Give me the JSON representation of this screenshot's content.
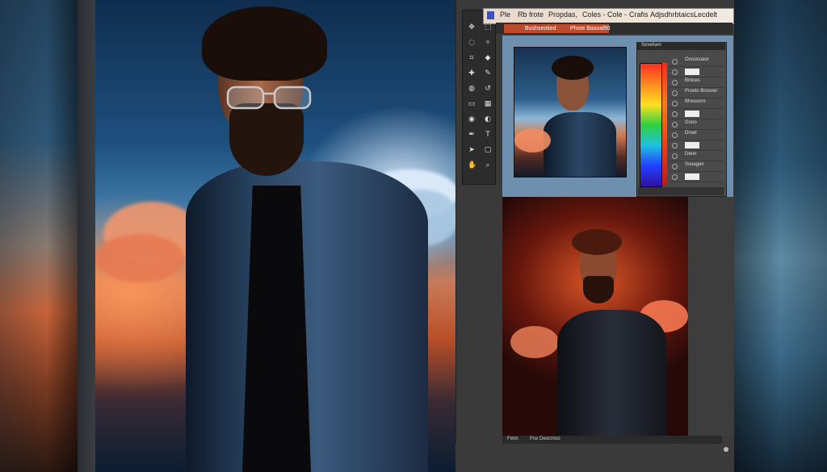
{
  "app": {
    "menu": [
      "Ple",
      "Rb frote",
      "Propdas,",
      "Coles - Cole -",
      "Crafis",
      "Adjsdhrbtaics",
      "Lecdelt"
    ],
    "tab_left": "Bushseotied",
    "tab_right": "Phote Basoal90"
  },
  "panel": {
    "header": "Sovelsen",
    "layers": [
      {
        "label": "Oooocoaor"
      },
      {
        "label": ""
      },
      {
        "label": "Bntoes"
      },
      {
        "label": "Proeto Broover"
      },
      {
        "label": "Bheosoro"
      },
      {
        "label": ""
      },
      {
        "label": "Gooo"
      },
      {
        "label": "Droet"
      },
      {
        "label": ""
      },
      {
        "label": "Dteer"
      },
      {
        "label": "Ssoagen"
      },
      {
        "label": ""
      }
    ]
  },
  "status": {
    "zoom": "Fetm",
    "info": "Pce Deocmoo"
  },
  "colors": {
    "tab_accent": "#bd4a2c",
    "menubar": "#f3eadf"
  },
  "icons": [
    "move-icon",
    "marquee-icon",
    "lasso-icon",
    "magic-wand-icon",
    "crop-icon",
    "eyedropper-icon",
    "healing-icon",
    "brush-icon",
    "stamp-icon",
    "history-brush-icon",
    "eraser-icon",
    "gradient-icon",
    "blur-icon",
    "dodge-icon",
    "pen-icon",
    "type-icon",
    "path-select-icon",
    "shape-icon",
    "hand-icon",
    "zoom-icon"
  ]
}
